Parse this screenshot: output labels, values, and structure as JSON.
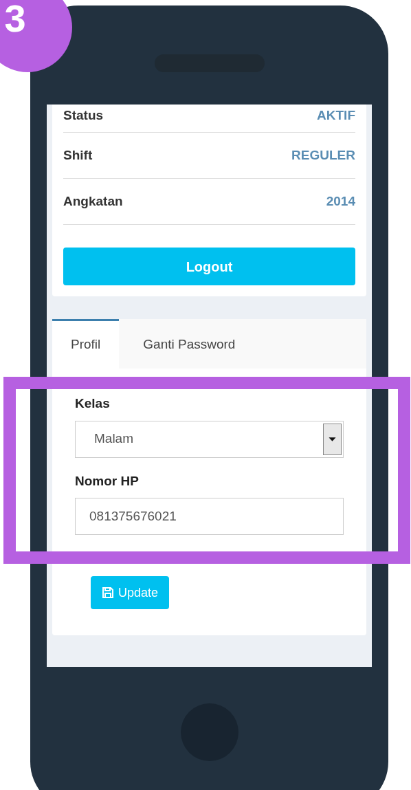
{
  "step_badge": "3",
  "info_rows": [
    {
      "label": "Status",
      "value": "AKTIF"
    },
    {
      "label": "Shift",
      "value": "REGULER"
    },
    {
      "label": "Angkatan",
      "value": "2014"
    }
  ],
  "logout_button": "Logout",
  "tabs": [
    {
      "label": "Profil",
      "selected": true
    },
    {
      "label": "Ganti Password",
      "selected": false
    }
  ],
  "form": {
    "fields": [
      {
        "kind": "select",
        "label": "Kelas",
        "value": "Malam"
      },
      {
        "kind": "text",
        "label": "Nomor HP",
        "value": "081375676021"
      }
    ]
  },
  "update_button": "Update"
}
